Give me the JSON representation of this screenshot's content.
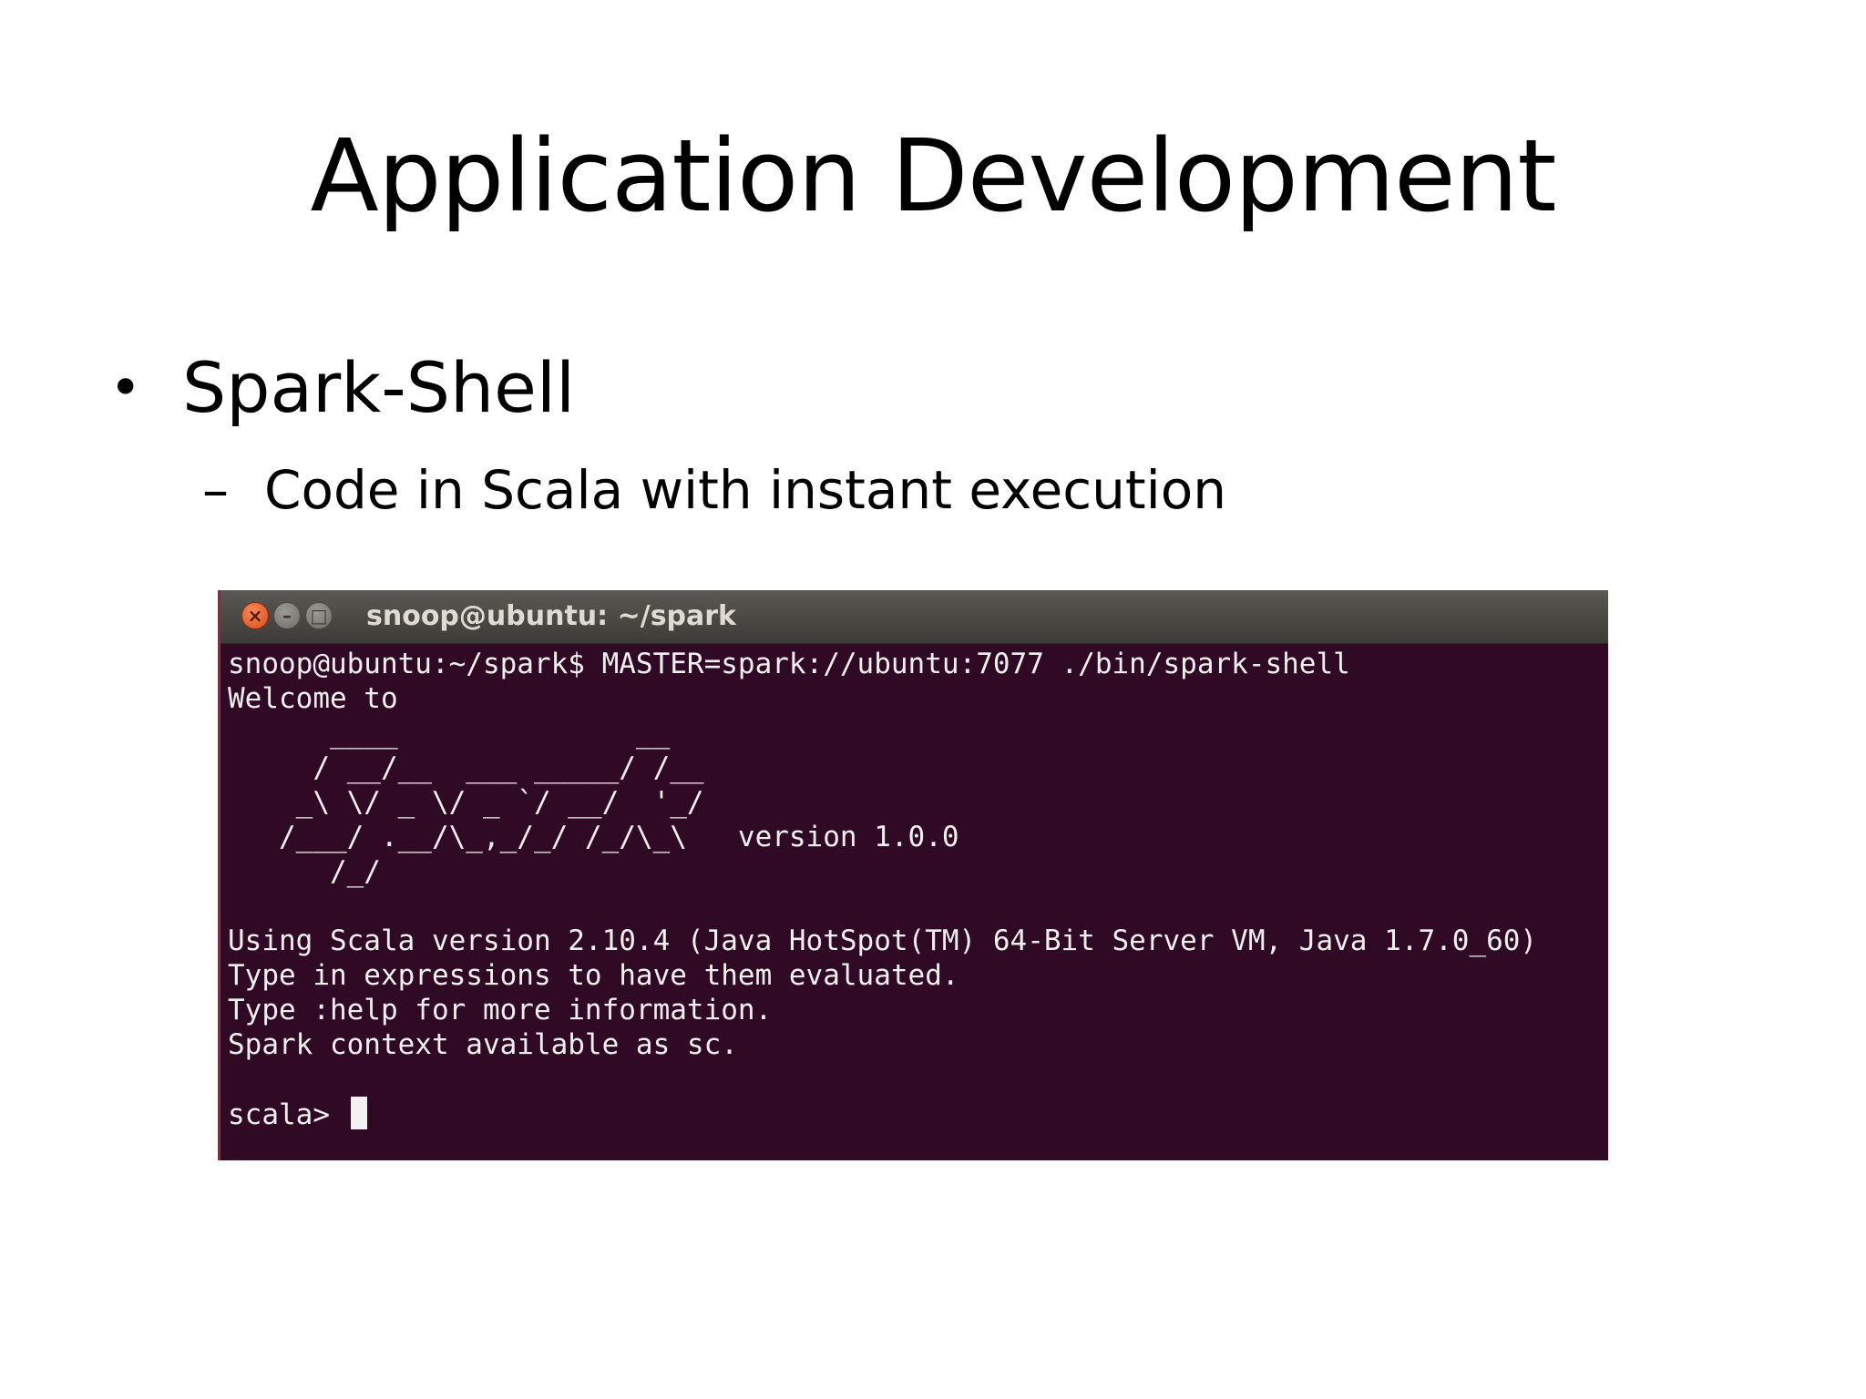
{
  "slide": {
    "title": "Application Development",
    "bullet_1": "Spark-Shell",
    "bullet_1_marker": "•",
    "bullet_2": "Code in Scala with instant execution",
    "bullet_2_marker": "–"
  },
  "terminal": {
    "window_title": "snoop@ubuntu: ~/spark",
    "close_glyph": "×",
    "minimize_glyph": "–",
    "maximize_glyph": "□",
    "lines": [
      "snoop@ubuntu:~/spark$ MASTER=spark://ubuntu:7077 ./bin/spark-shell",
      "Welcome to",
      "      ____              __",
      "     / __/__  ___ _____/ /__",
      "    _\\ \\/ _ \\/ _ `/ __/  '_/",
      "   /___/ .__/\\_,_/_/ /_/\\_\\   version 1.0.0",
      "      /_/",
      "Using Scala version 2.10.4 (Java HotSpot(TM) 64-Bit Server VM, Java 1.7.0_60)",
      "Type in expressions to have them evaluated.",
      "Type :help for more information.",
      "Spark context available as sc.",
      "scala> "
    ],
    "colors": {
      "background": "#300a24",
      "text": "#eeeeec",
      "titlebar": "#3c3b37",
      "close_button": "#df4a16"
    }
  }
}
